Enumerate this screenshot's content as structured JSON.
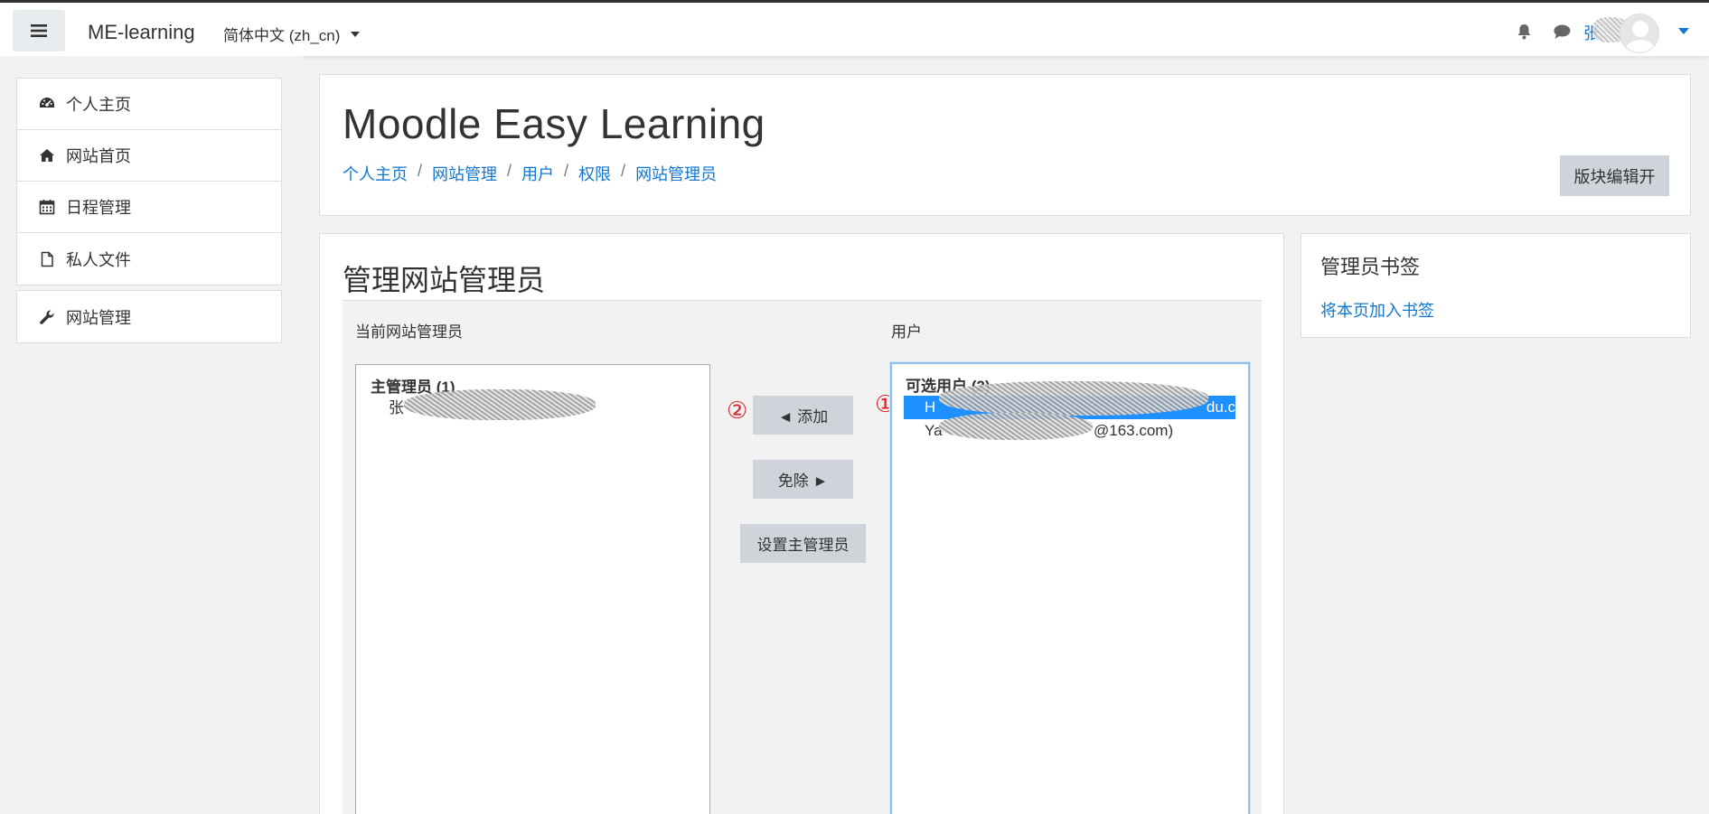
{
  "navbar": {
    "brand": "ME-learning",
    "language": "简体中文 (zh_cn)",
    "username": "张"
  },
  "drawer": {
    "items": [
      {
        "label": "个人主页",
        "icon": "dashboard-icon"
      },
      {
        "label": "网站首页",
        "icon": "home-icon"
      },
      {
        "label": "日程管理",
        "icon": "calendar-icon"
      },
      {
        "label": "私人文件",
        "icon": "file-icon"
      }
    ],
    "admin": {
      "label": "网站管理",
      "icon": "wrench-icon"
    }
  },
  "header": {
    "title": "Moodle Easy Learning",
    "breadcrumb": [
      "个人主页",
      "网站管理",
      "用户",
      "权限",
      "网站管理员"
    ],
    "blocks_button": "版块编辑开"
  },
  "main": {
    "heading": "管理网站管理员",
    "current_label": "当前网站管理员",
    "users_label": "用户",
    "current_list": {
      "group": "主管理员 (1)",
      "options": [
        "张"
      ]
    },
    "users_list": {
      "group": "可选用户 (2)",
      "options": [
        {
          "text": "H",
          "tail": "du.c",
          "selected": true
        },
        {
          "text": "Ya",
          "tail": "@163.com)",
          "selected": false
        }
      ]
    },
    "buttons": {
      "add": "◄ 添加",
      "remove": "免除 ►",
      "set_main": "设置主管理员"
    },
    "markers": {
      "one": "①",
      "two": "②"
    }
  },
  "bookmarks": {
    "title": "管理员书签",
    "link": "将本页加入书签"
  }
}
